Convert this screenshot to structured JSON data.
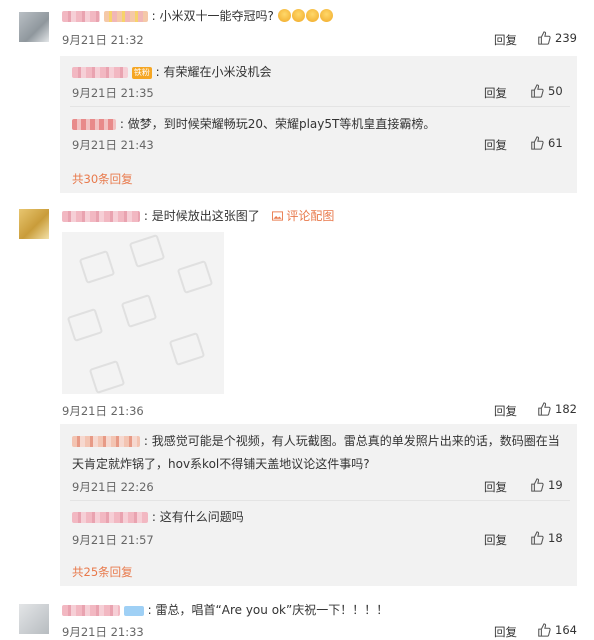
{
  "comments": [
    {
      "text": "小米双十一能夺冠吗?",
      "time": "9月21日 21:32",
      "reply_label": "回复",
      "likes": "239",
      "replies": [
        {
          "text": "有荣耀在小米没机会",
          "time": "9月21日 21:35",
          "reply_label": "回复",
          "likes": "50"
        },
        {
          "text": "做梦，到时候荣耀畅玩20、荣耀play5T等机皇直接霸榜。",
          "time": "9月21日 21:43",
          "reply_label": "回复",
          "likes": "61"
        }
      ],
      "more_replies": "共30条回复"
    },
    {
      "text": "是时候放出这张图了",
      "pic_link": "评论配图",
      "time": "9月21日 21:36",
      "reply_label": "回复",
      "likes": "182",
      "replies": [
        {
          "text_line1": "我感觉可能是个视频，有人玩截图。雷总真的单发照片出来的话，数码圈在当",
          "text_line2": "天肯定就炸锅了，hov系kol不得铺天盖地议论这件事吗?",
          "time": "9月21日 22:26",
          "reply_label": "回复",
          "likes": "19"
        },
        {
          "text": "这有什么问题吗",
          "time": "9月21日 21:57",
          "reply_label": "回复",
          "likes": "18"
        }
      ],
      "more_replies": "共25条回复"
    },
    {
      "text": "雷总，唱首“Are you ok”庆祝一下！！！！",
      "time": "9月21日 21:33",
      "reply_label": "回复",
      "likes": "164"
    }
  ],
  "colors": {
    "accent": "#e8794b",
    "thread_bg": "#f2f2f2",
    "text": "#333333"
  },
  "icons": {
    "like": "thumbs-up-icon",
    "picture": "image-icon"
  }
}
